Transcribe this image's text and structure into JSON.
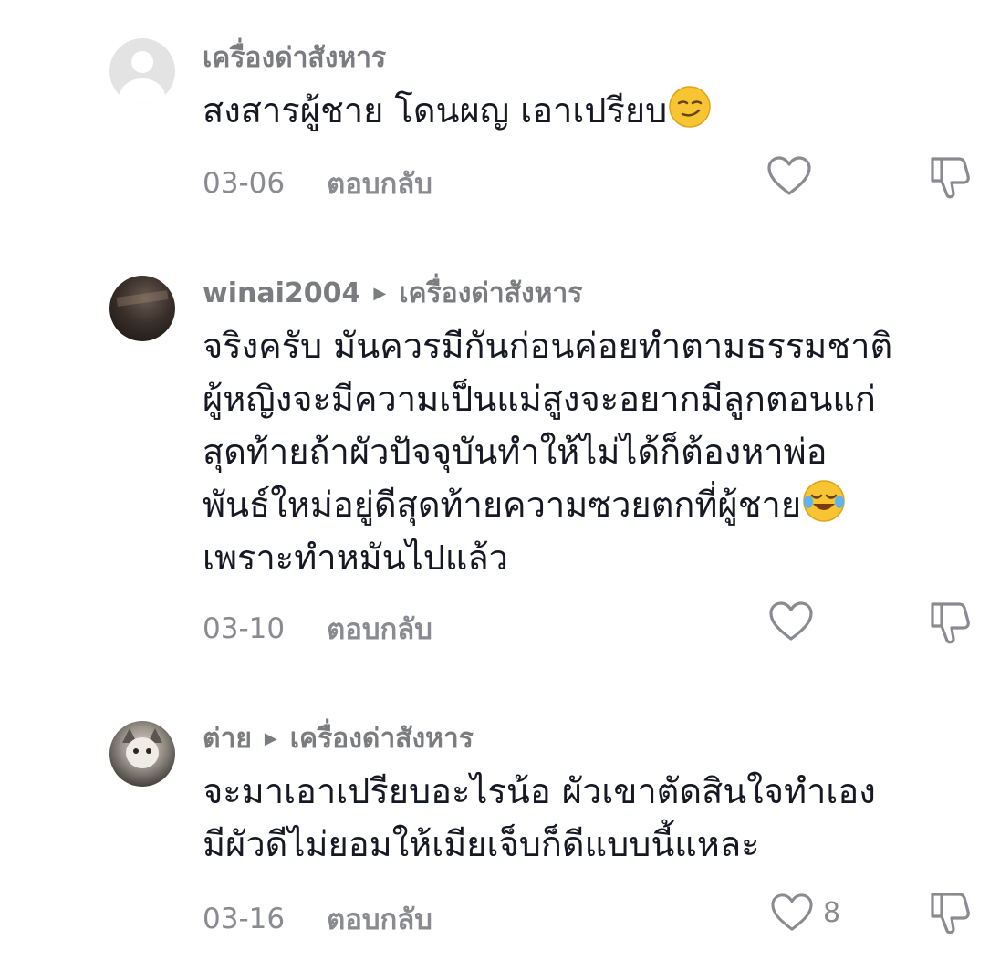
{
  "comments": [
    {
      "username": "เครื่องด่าสังหาร",
      "reply_to": "",
      "avatar": "default-avatar-icon",
      "lines": [
        "สงสารผู้ชาย โดนผญ เอาเปรียบ"
      ],
      "emoji": "smirking-face-emoji",
      "date": "03-06",
      "reply_label": "ตอบกลับ",
      "like_count": ""
    },
    {
      "username": "winai2004",
      "reply_to": "เครื่องด่าสังหาร",
      "avatar": "user-photo-avatar",
      "lines": [
        "จริงครับ มันควรมีกันก่อนค่อยทำตามธรรมชาติ",
        "ผู้หญิงจะมีความเป็นแม่สูงจะอยากมีลูกตอนแก่",
        "สุดท้ายถ้าผัวปัจจุบันทำให้ไม่ได้ก็ต้องหาพ่อ",
        "พันธ์ใหม่อยู่ดีสุดท้ายความซวยตกที่ผู้ชาย",
        "เพราะทำหมันไปแล้ว"
      ],
      "emoji": "tears-of-joy-emoji",
      "date": "03-10",
      "reply_label": "ตอบกลับ",
      "like_count": ""
    },
    {
      "username": "ต่าย",
      "reply_to": "เครื่องด่าสังหาร",
      "avatar": "cat-photo-avatar",
      "lines": [
        "จะมาเอาเปรียบอะไรน้อ ผัวเขาตัดสินใจทำเอง",
        "มีผัวดีไม่ยอมให้เมียเจ็บก็ดีแบบนี้แหละ"
      ],
      "emoji": "",
      "date": "03-16",
      "reply_label": "ตอบกลับ",
      "like_count": "8"
    }
  ],
  "icons": {
    "like": "heart-outline-icon",
    "dislike": "thumbs-down-outline-icon",
    "reply_arrow": "play-arrow-icon"
  },
  "colors": {
    "text_primary": "#161823",
    "text_secondary": "#8a8b91",
    "icon_stroke": "#8a8b91"
  }
}
